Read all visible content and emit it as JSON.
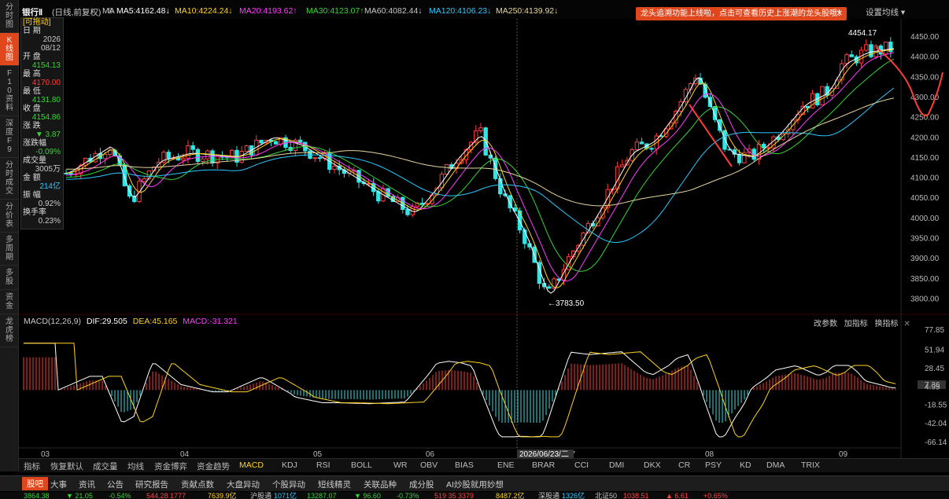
{
  "app": {
    "title": "银行Ⅱ",
    "mode": "(日线,前复权)",
    "settings_label": "设置均线",
    "notice_text": "龙头追溯功能上线啦，点击可查看历史上涨潮的龙头股哦！",
    "notice_close": "✕"
  },
  "sidebar": [
    {
      "label": "分时图",
      "active": false
    },
    {
      "label": "K线图",
      "active": true
    },
    {
      "label": "F10资料",
      "active": false
    },
    {
      "label": "深度F9",
      "active": false
    },
    {
      "label": "分时成交",
      "active": false
    },
    {
      "label": "分价表",
      "active": false
    },
    {
      "label": "多周期",
      "active": false
    },
    {
      "label": "多股",
      "active": false
    },
    {
      "label": "资金",
      "active": false
    },
    {
      "label": "龙虎榜",
      "active": false
    }
  ],
  "info_panel": {
    "title": "[可拖动]",
    "date_label": "日 期",
    "date_year": "2026",
    "date_md": "08/12",
    "open_label": "开 盘",
    "open": "4154.13",
    "high_label": "最 高",
    "high": "4170.00",
    "low_label": "最 低",
    "low": "4131.80",
    "close_label": "收 盘",
    "close": "4154.86",
    "change_label": "涨 跌",
    "change": "▼ 3.87",
    "change_pct_label": "涨跌幅",
    "change_pct": "-0.09%",
    "volume_label": "成交量",
    "volume": "3005万",
    "amount_label": "金 额",
    "amount": "214亿",
    "amplitude_label": "振 幅",
    "amplitude": "0.92%",
    "turnover_label": "换手率",
    "turnover": "0.23%"
  },
  "ma_bar": [
    {
      "text": "MA",
      "color": "#c8c8c8"
    },
    {
      "text": "MA5:4162.48↓",
      "color": "#ffffff"
    },
    {
      "text": "MA10:4224.24↓",
      "color": "#ffd21f"
    },
    {
      "text": "MA20:4193.62↑",
      "color": "#ff3cff"
    },
    {
      "text": "MA30:4123.07↑",
      "color": "#36d436"
    },
    {
      "text": "MA60:4082.44↓",
      "color": "#c8c8c8"
    },
    {
      "text": "MA120:4106.23↓",
      "color": "#2ec8ff"
    },
    {
      "text": "MA250:4139.92↓",
      "color": "#e6d59a"
    }
  ],
  "price_axis": [
    "4450.00",
    "4400.00",
    "4350.00",
    "4300.00",
    "4250.00",
    "4200.00",
    "4150.00",
    "4100.00",
    "4050.00",
    "4000.00",
    "3950.00",
    "3900.00",
    "3850.00",
    "3800.00"
  ],
  "annotations": {
    "high_mark": "4454.17",
    "low_mark": "←3783.50",
    "crosshair_date": "2026/06/23/二"
  },
  "macd": {
    "title": "MACD(12,26,9)",
    "dif": "DIF:29.505",
    "dea": "DEA:45.165",
    "macd": "MACD:-31.321",
    "links": [
      "改参数",
      "加指标",
      "换指标"
    ],
    "axis": [
      "77.85",
      "51.94",
      "28.45",
      "7.36",
      "4.95",
      "-18.55",
      "-42.04",
      "-66.14"
    ]
  },
  "x_axis": [
    "03",
    "04",
    "05",
    "06",
    "07",
    "08",
    "09"
  ],
  "indicator_tabs": [
    "指标",
    "恢复默认",
    "成交量",
    "均线",
    "资金博弈",
    "资金趋势",
    "MACD",
    "KDJ",
    "RSI",
    "BOLL",
    "WR",
    "OBV",
    "BIAS",
    "ENE",
    "BRAR",
    "CCI",
    "DMI",
    "DKX",
    "CR",
    "PSY",
    "KD",
    "DMA",
    "TRIX"
  ],
  "nav_tabs": [
    "股吧",
    "大事",
    "资讯",
    "公告",
    "研究报告",
    "贡献点数",
    "大盘异动",
    "个股异动",
    "短线精灵",
    "关联品种",
    "成分股",
    "AI炒股就用妙想"
  ],
  "ticker": [
    {
      "text": "3864.38",
      "color": "#36d436"
    },
    {
      "text": "▼ 21.05",
      "color": "#36d436"
    },
    {
      "text": "-0.54%",
      "color": "#36d436"
    },
    {
      "text": "544.28 1777",
      "color": "#ff4444"
    },
    {
      "text": "7639.9亿",
      "color": "#ffd21f"
    },
    {
      "text": "沪股通",
      "color": "#c8c8c8"
    },
    {
      "text": "1071亿",
      "color": "#2ec8ff"
    },
    {
      "text": "13287.07",
      "color": "#36d436"
    },
    {
      "text": "▼ 96.60",
      "color": "#36d436"
    },
    {
      "text": "-0.73%",
      "color": "#36d436"
    },
    {
      "text": "519 35 3379",
      "color": "#ff4444"
    },
    {
      "text": "8487.2亿",
      "color": "#ffd21f"
    },
    {
      "text": "深股通",
      "color": "#c8c8c8"
    },
    {
      "text": "1326亿",
      "color": "#2ec8ff"
    },
    {
      "text": "北证50",
      "color": "#c8c8c8"
    },
    {
      "text": "1038.51",
      "color": "#ff4444"
    },
    {
      "text": "▲ 6.61",
      "color": "#ff4444"
    },
    {
      "text": "+0.65%",
      "color": "#ff4444"
    }
  ],
  "colors": {
    "up": "#ff3d3d",
    "down": "#2ee6e6",
    "accent": "#e0471c"
  }
}
